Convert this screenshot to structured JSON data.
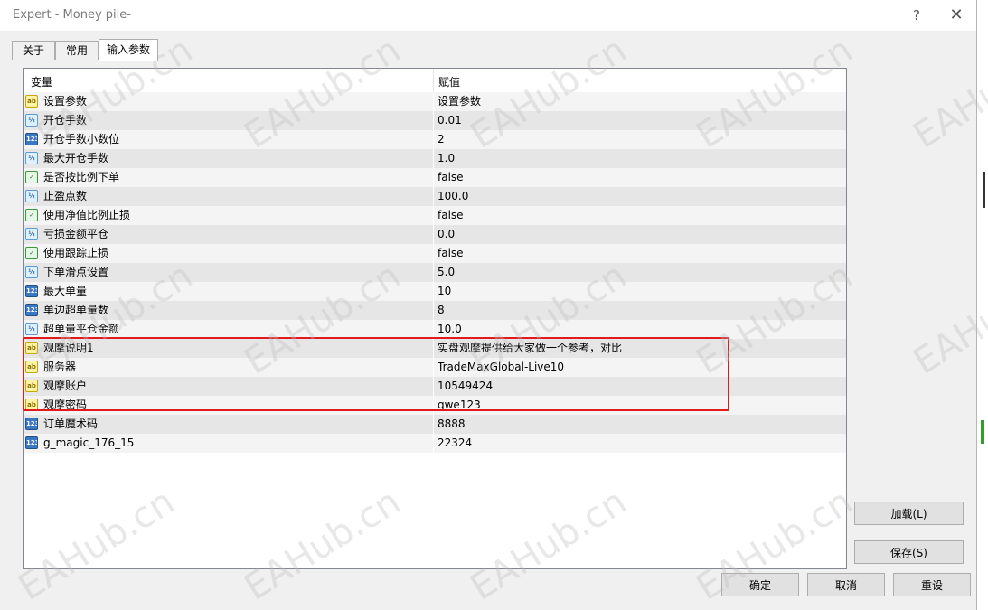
{
  "window": {
    "title": "Expert - Money pile-",
    "help_glyph": "?",
    "close_glyph": "✕"
  },
  "tabs": [
    {
      "label": "关于",
      "active": false
    },
    {
      "label": "常用",
      "active": false
    },
    {
      "label": "输入参数",
      "active": true
    }
  ],
  "table": {
    "headers": {
      "variable": "变量",
      "value": "赋值"
    },
    "rows": [
      {
        "icon": "ab",
        "name": "设置参数",
        "value": "设置参数"
      },
      {
        "icon": "half",
        "name": "开仓手数",
        "value": "0.01"
      },
      {
        "icon": "123",
        "name": "开仓手数小数位",
        "value": "2"
      },
      {
        "icon": "half",
        "name": "最大开仓手数",
        "value": "1.0"
      },
      {
        "icon": "bool",
        "name": "是否按比例下单",
        "value": "false"
      },
      {
        "icon": "half",
        "name": "止盈点数",
        "value": "100.0"
      },
      {
        "icon": "bool",
        "name": "使用净值比例止损",
        "value": "false"
      },
      {
        "icon": "half",
        "name": "亏损金额平仓",
        "value": "0.0"
      },
      {
        "icon": "bool",
        "name": "使用跟踪止损",
        "value": "false"
      },
      {
        "icon": "half",
        "name": "下单滑点设置",
        "value": "5.0"
      },
      {
        "icon": "123",
        "name": "最大单量",
        "value": "10"
      },
      {
        "icon": "123",
        "name": "单边超单量数",
        "value": "8"
      },
      {
        "icon": "half",
        "name": "超单量平仓金额",
        "value": "10.0"
      },
      {
        "icon": "ab",
        "name": "观摩说明1",
        "value": "实盘观摩提供给大家做一个参考，对比"
      },
      {
        "icon": "ab",
        "name": "服务器",
        "value": "TradeMaxGlobal-Live10"
      },
      {
        "icon": "ab",
        "name": "观摩账户",
        "value": "10549424"
      },
      {
        "icon": "ab",
        "name": "观摩密码",
        "value": "qwe123"
      },
      {
        "icon": "123",
        "name": "订单魔术码",
        "value": "8888"
      },
      {
        "icon": "123",
        "name": "g_magic_176_15",
        "value": "22324"
      }
    ]
  },
  "icon_glyphs": {
    "ab": "ab",
    "half": "½",
    "123": "123",
    "bool": "✓"
  },
  "buttons": {
    "load": "加载(L)",
    "save": "保存(S)",
    "ok": "确定",
    "cancel": "取消",
    "reset": "重设"
  },
  "watermark": "EAHub.cn",
  "colors": {
    "highlight": "#e11b1b",
    "row_odd": "#f4f4f4",
    "row_even": "#e6e6e6"
  }
}
